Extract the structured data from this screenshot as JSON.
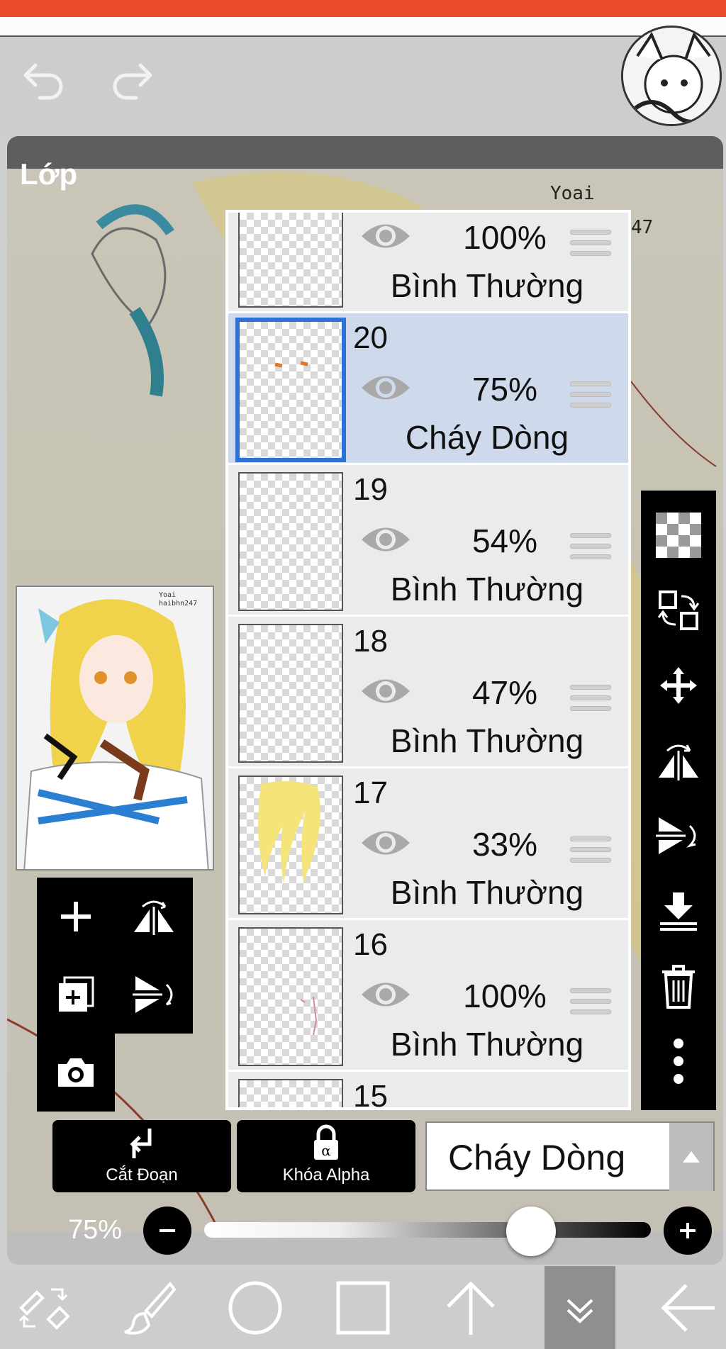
{
  "panel": {
    "title": "Lớp"
  },
  "canvas": {
    "signature_line1": "Yoai",
    "signature_line2": "47"
  },
  "preview": {
    "signature": "Yoai\nhaibhn247"
  },
  "layers": [
    {
      "number": "",
      "opacity": "100%",
      "blend": "Bình Thường",
      "selected": false
    },
    {
      "number": "20",
      "opacity": "75%",
      "blend": "Cháy Dòng",
      "selected": true
    },
    {
      "number": "19",
      "opacity": "54%",
      "blend": "Bình Thường",
      "selected": false
    },
    {
      "number": "18",
      "opacity": "47%",
      "blend": "Bình Thường",
      "selected": false
    },
    {
      "number": "17",
      "opacity": "33%",
      "blend": "Bình Thường",
      "selected": false
    },
    {
      "number": "16",
      "opacity": "100%",
      "blend": "Bình Thường",
      "selected": false
    },
    {
      "number": "15",
      "opacity": "",
      "blend": "",
      "selected": false
    }
  ],
  "actions": {
    "clip_label": "Cắt Đoạn",
    "alpha_lock_label": "Khóa Alpha"
  },
  "blend_mode": {
    "current": "Cháy Dòng"
  },
  "opacity": {
    "value_label": "75%",
    "value": 75
  },
  "colors": {
    "selected_row": "#cfd9ec",
    "selected_border": "#2b73d6",
    "accent_top": "#e84a2a"
  }
}
